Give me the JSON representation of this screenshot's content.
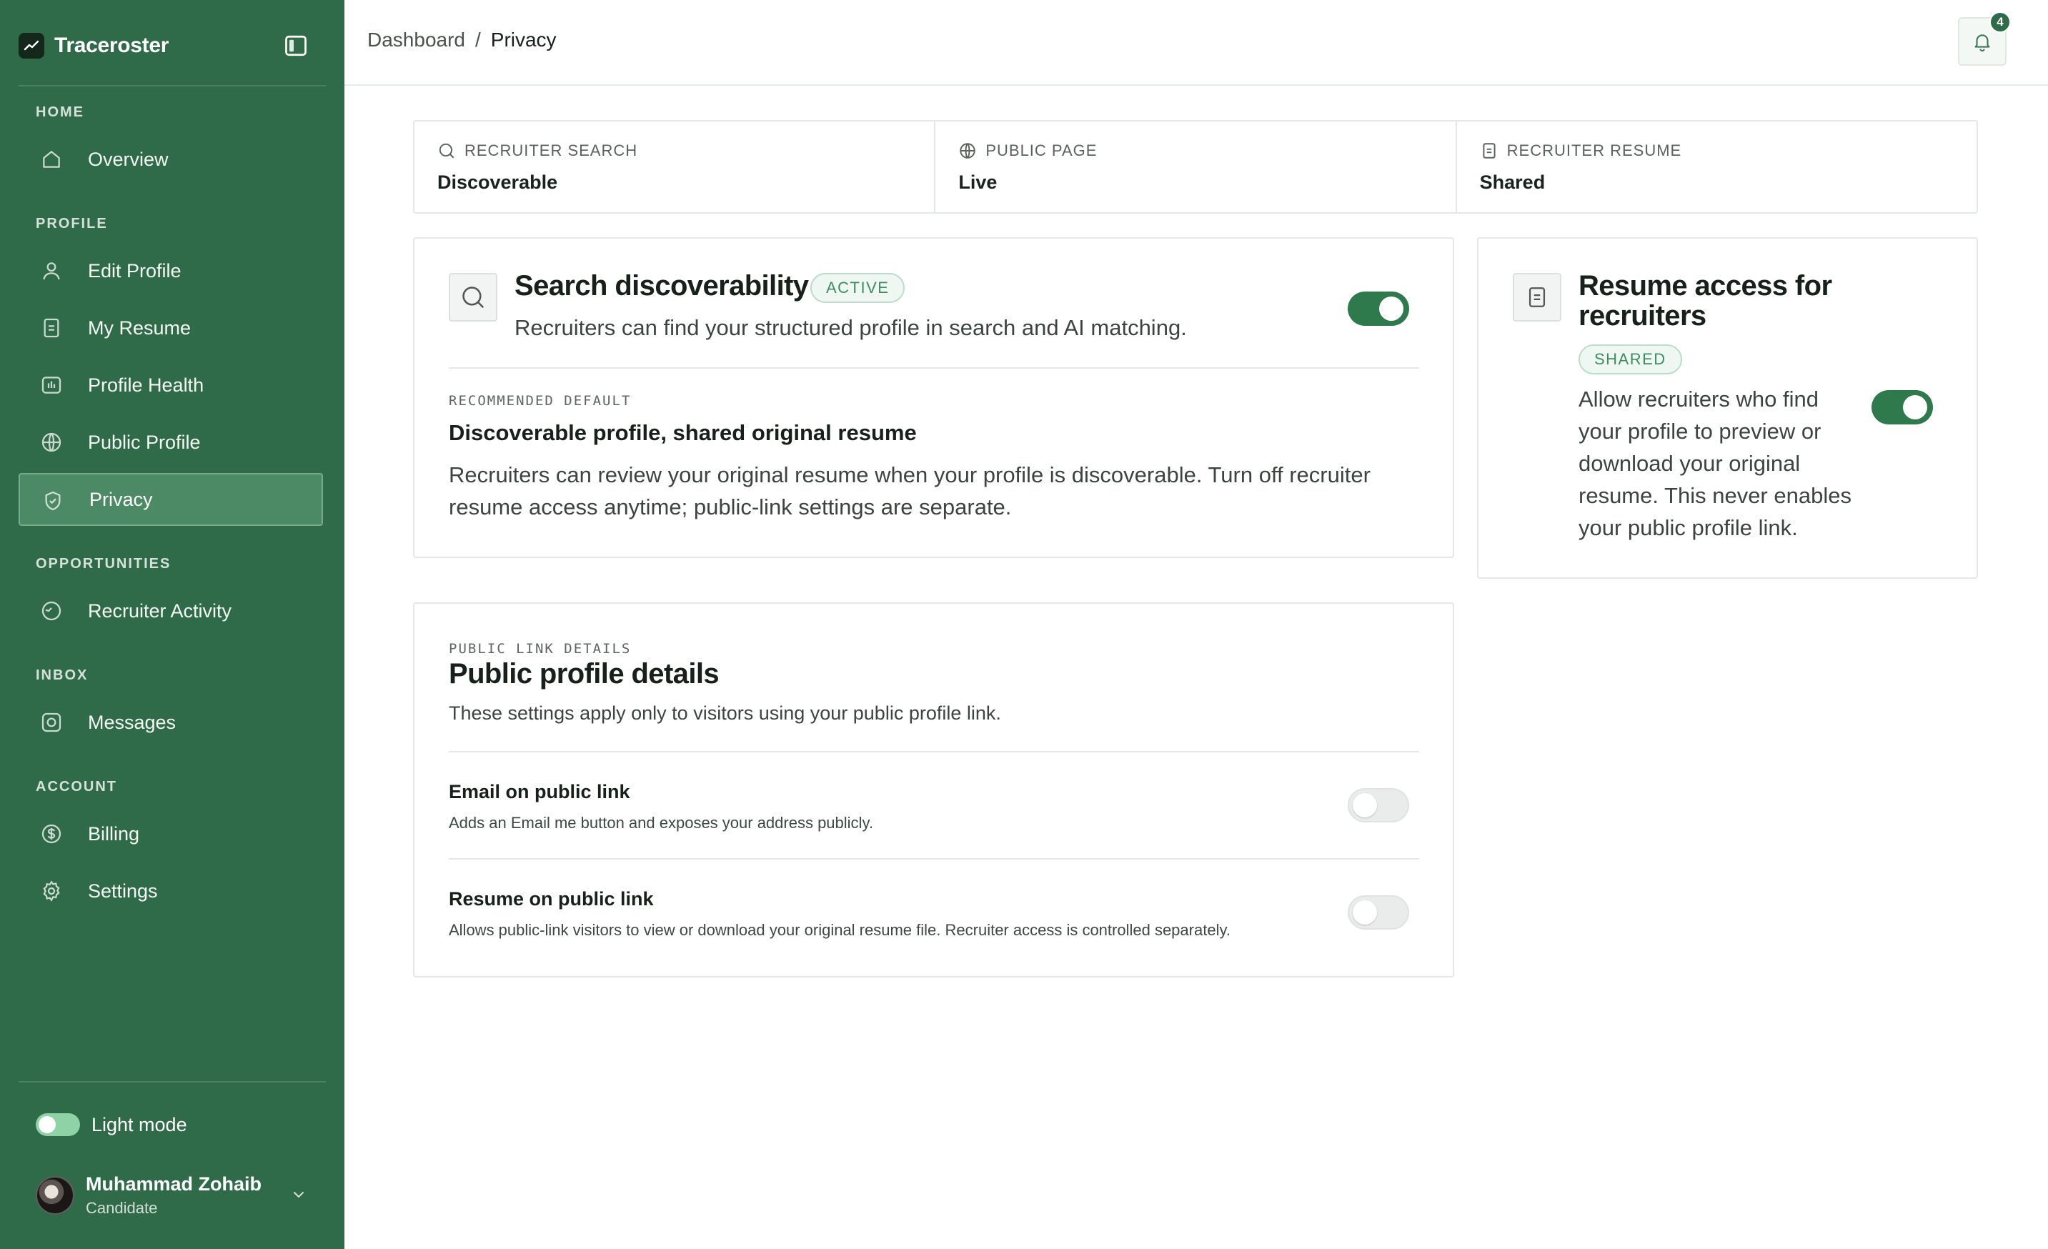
{
  "app": {
    "name": "Traceroster"
  },
  "sidebar": {
    "sections": [
      {
        "label": "HOME",
        "items": [
          {
            "label": "Overview",
            "icon": "home-icon"
          }
        ]
      },
      {
        "label": "PROFILE",
        "items": [
          {
            "label": "Edit Profile",
            "icon": "user-icon"
          },
          {
            "label": "My Resume",
            "icon": "document-icon"
          },
          {
            "label": "Profile Health",
            "icon": "chart-icon"
          },
          {
            "label": "Public Profile",
            "icon": "globe-icon"
          },
          {
            "label": "Privacy",
            "icon": "shield-check-icon",
            "active": true
          }
        ]
      },
      {
        "label": "OPPORTUNITIES",
        "items": [
          {
            "label": "Recruiter Activity",
            "icon": "activity-icon"
          }
        ]
      },
      {
        "label": "INBOX",
        "items": [
          {
            "label": "Messages",
            "icon": "inbox-icon"
          }
        ]
      },
      {
        "label": "ACCOUNT",
        "items": [
          {
            "label": "Billing",
            "icon": "dollar-icon"
          },
          {
            "label": "Settings",
            "icon": "gear-icon"
          }
        ]
      }
    ],
    "theme_toggle": {
      "label": "Light mode",
      "on": true
    },
    "user": {
      "name": "Muhammad Zohaib",
      "role": "Candidate"
    }
  },
  "header": {
    "breadcrumb": {
      "root": "Dashboard",
      "separator": "/",
      "current": "Privacy"
    },
    "notifications": {
      "count": "4"
    }
  },
  "status": [
    {
      "label": "RECRUITER SEARCH",
      "value": "Discoverable",
      "icon": "search-icon"
    },
    {
      "label": "PUBLIC PAGE",
      "value": "Live",
      "icon": "globe-icon"
    },
    {
      "label": "RECRUITER RESUME",
      "value": "Shared",
      "icon": "document-icon"
    }
  ],
  "discoverability": {
    "title": "Search discoverability",
    "badge": "ACTIVE",
    "description": "Recruiters can find your structured profile in search and AI matching.",
    "enabled": true,
    "default_label": "RECOMMENDED DEFAULT",
    "default_title": "Discoverable profile, shared original resume",
    "default_body_line1": "Recruiters can review your original resume when your profile is discoverable. Turn off recruiter",
    "default_body_line2": "resume access anytime; public-link settings are separate."
  },
  "resume_access": {
    "title_line1": "Resume access for",
    "title_line2": "recruiters",
    "badge": "SHARED",
    "description_lines": [
      "Allow recruiters who find",
      "your profile to preview or",
      "download your original",
      "resume. This never enables",
      "your public profile link."
    ],
    "enabled": true
  },
  "public_link": {
    "label": "PUBLIC LINK DETAILS",
    "title": "Public profile details",
    "description": "These settings apply only to visitors using your public profile link.",
    "rows": [
      {
        "title": "Email on public link",
        "description": "Adds an Email me button and exposes your address publicly.",
        "enabled": false
      },
      {
        "title": "Resume on public link",
        "description": "Allows public-link visitors to view or download your original resume file. Recruiter access is controlled separately.",
        "enabled": false
      }
    ]
  },
  "colors": {
    "sidebar_bg": "#2f6b49",
    "accent": "#2f7a4c",
    "badge_text": "#3e8d62"
  }
}
